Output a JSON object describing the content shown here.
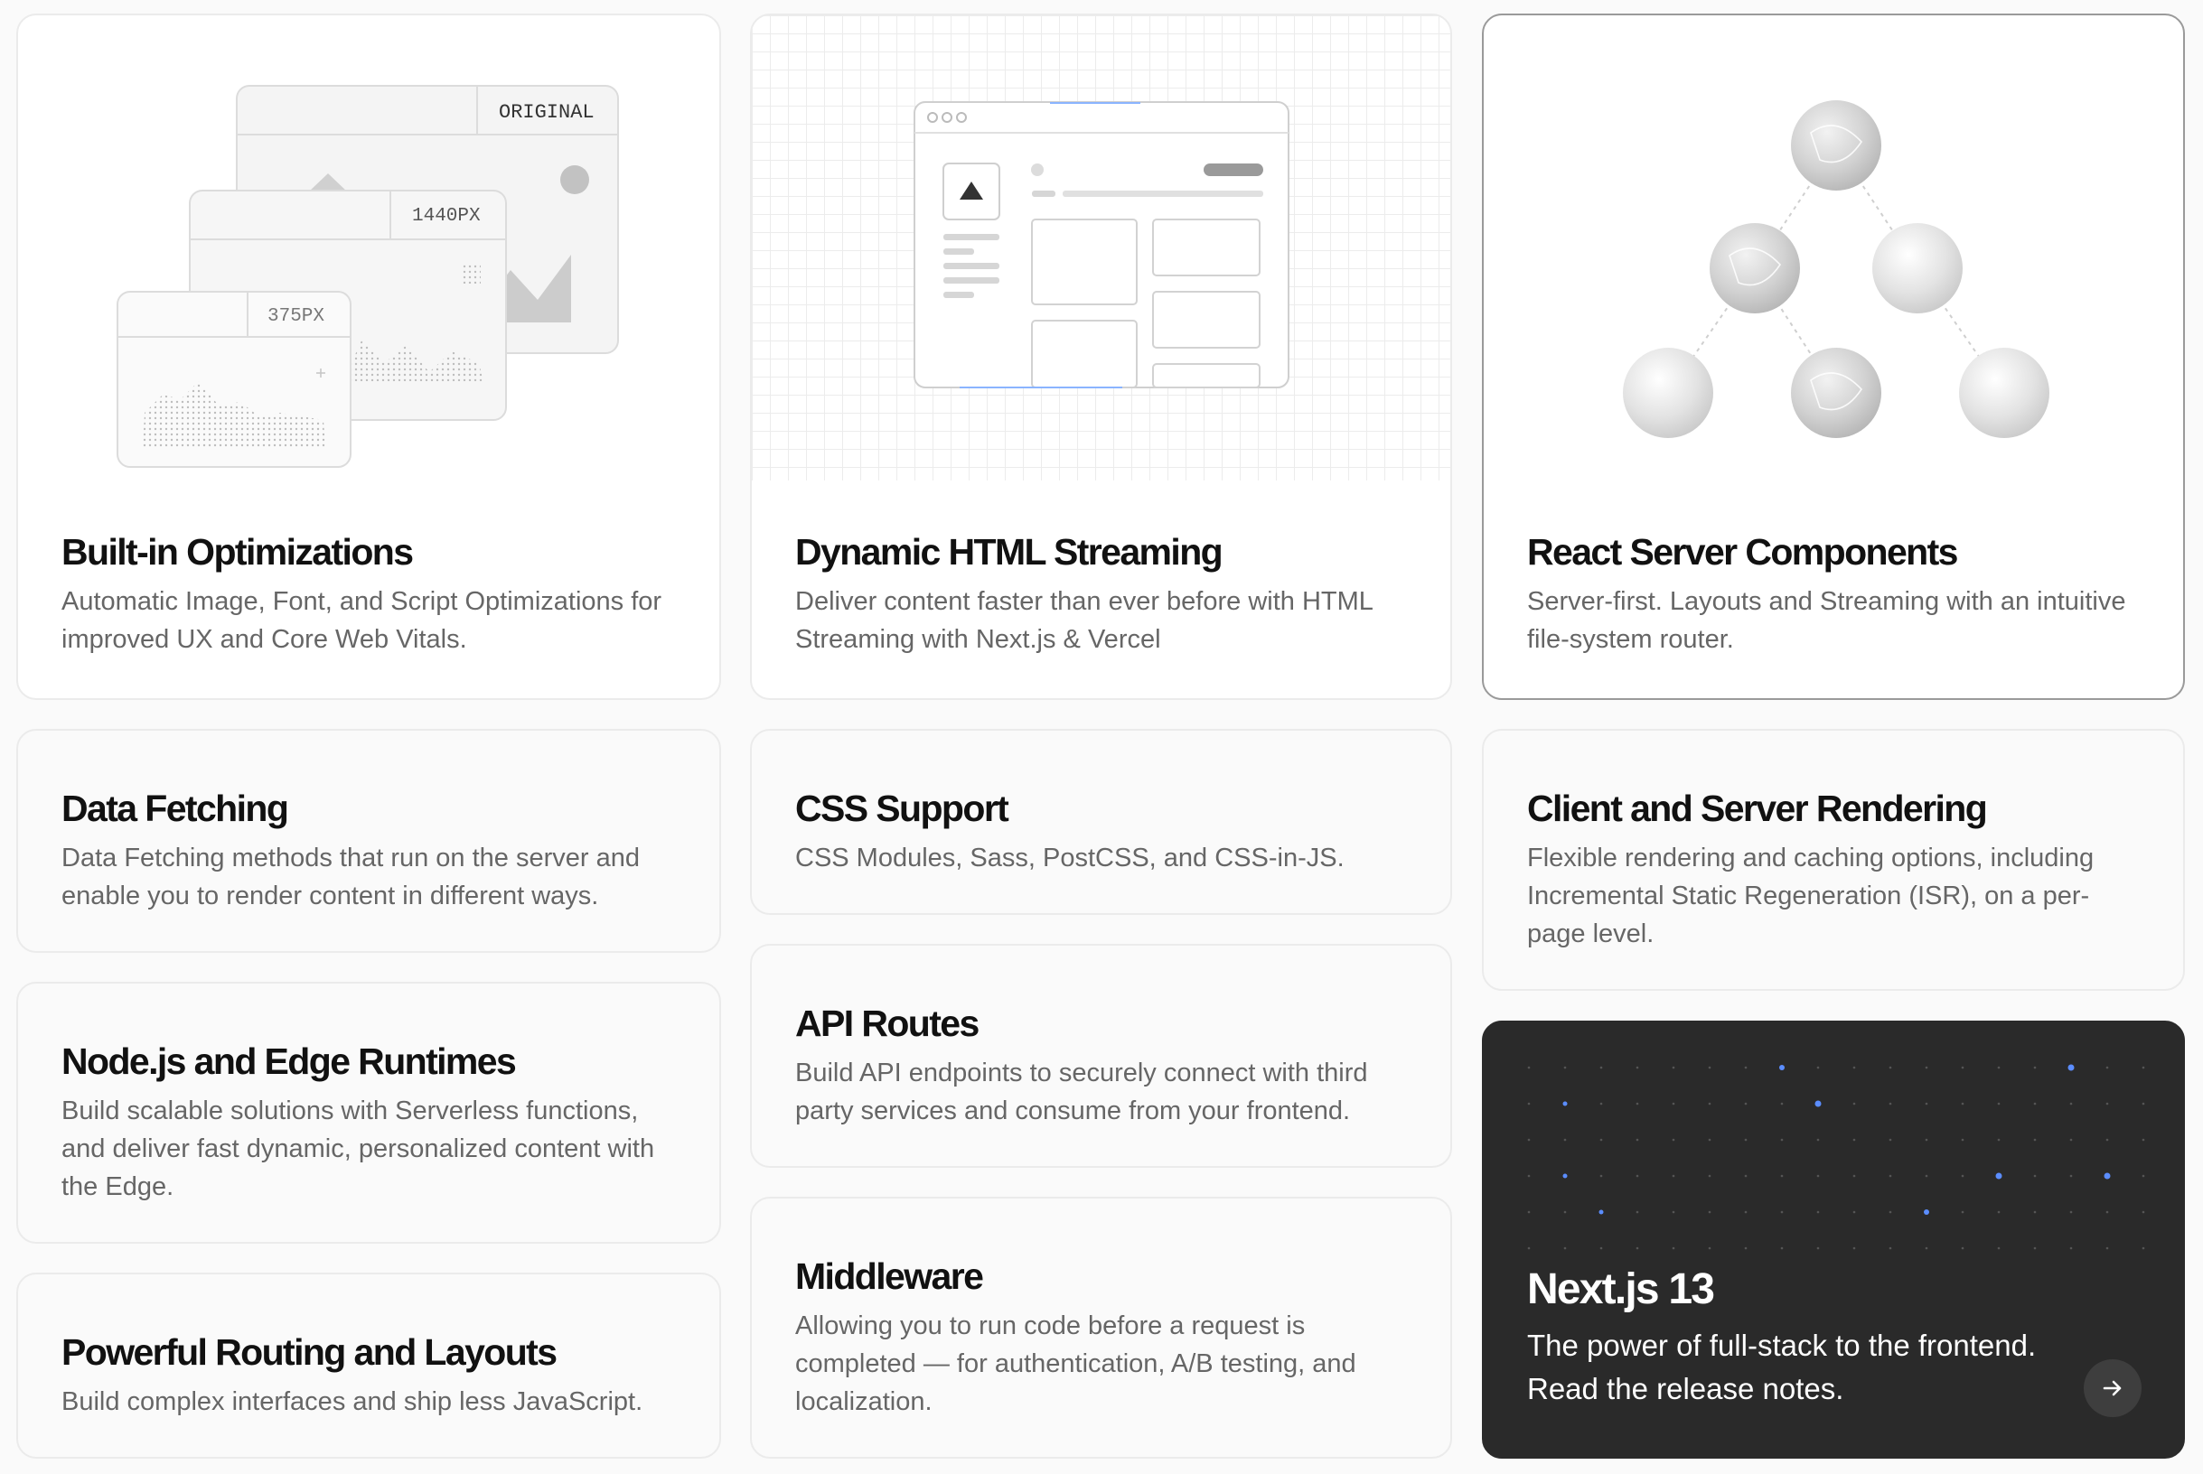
{
  "cards": [
    {
      "title": "Built-in Optimizations",
      "desc": "Automatic Image, Font, and Script Optimizations for improved UX and Core Web Vitals."
    },
    {
      "title": "Dynamic HTML Streaming",
      "desc": "Deliver content faster than ever before with HTML Streaming with Next.js & Vercel"
    },
    {
      "title": "React Server Components",
      "desc": "Server-first. Layouts and Streaming with an intuitive file-system router."
    },
    {
      "title": "Data Fetching",
      "desc": "Data Fetching methods that run on the server and enable you to render content in different ways."
    },
    {
      "title": "CSS Support",
      "desc": "CSS Modules, Sass, PostCSS, and CSS-in-JS."
    },
    {
      "title": "Client and Server Rendering",
      "desc": "Flexible rendering and caching options, including Incremental Static Regeneration (ISR), on a per-page level."
    },
    {
      "title": "Node.js and Edge Runtimes",
      "desc": "Build scalable solutions with Serverless functions, and deliver fast dynamic, personalized content with the Edge."
    },
    {
      "title": "API Routes",
      "desc": "Build API endpoints to securely connect with third party services and consume from your frontend."
    },
    {
      "title": "Powerful Routing and Layouts",
      "desc": "Build complex interfaces and ship less JavaScript."
    },
    {
      "title": "Middleware",
      "desc": "Allowing you to run code before a request is completed — for authentication, A/B testing, and localization."
    }
  ],
  "release": {
    "title": "Next.js 13",
    "desc": "The power of full-stack to the frontend. Read the release notes."
  },
  "image_opt": {
    "labels": [
      "ORIGINAL",
      "1440PX",
      "375PX"
    ]
  },
  "icons": {
    "arrow": "arrow-right-icon",
    "triangle": "triangle-icon"
  },
  "colors": {
    "accent_blue": "#5b8dff",
    "dark_card": "#2a2a2a"
  }
}
